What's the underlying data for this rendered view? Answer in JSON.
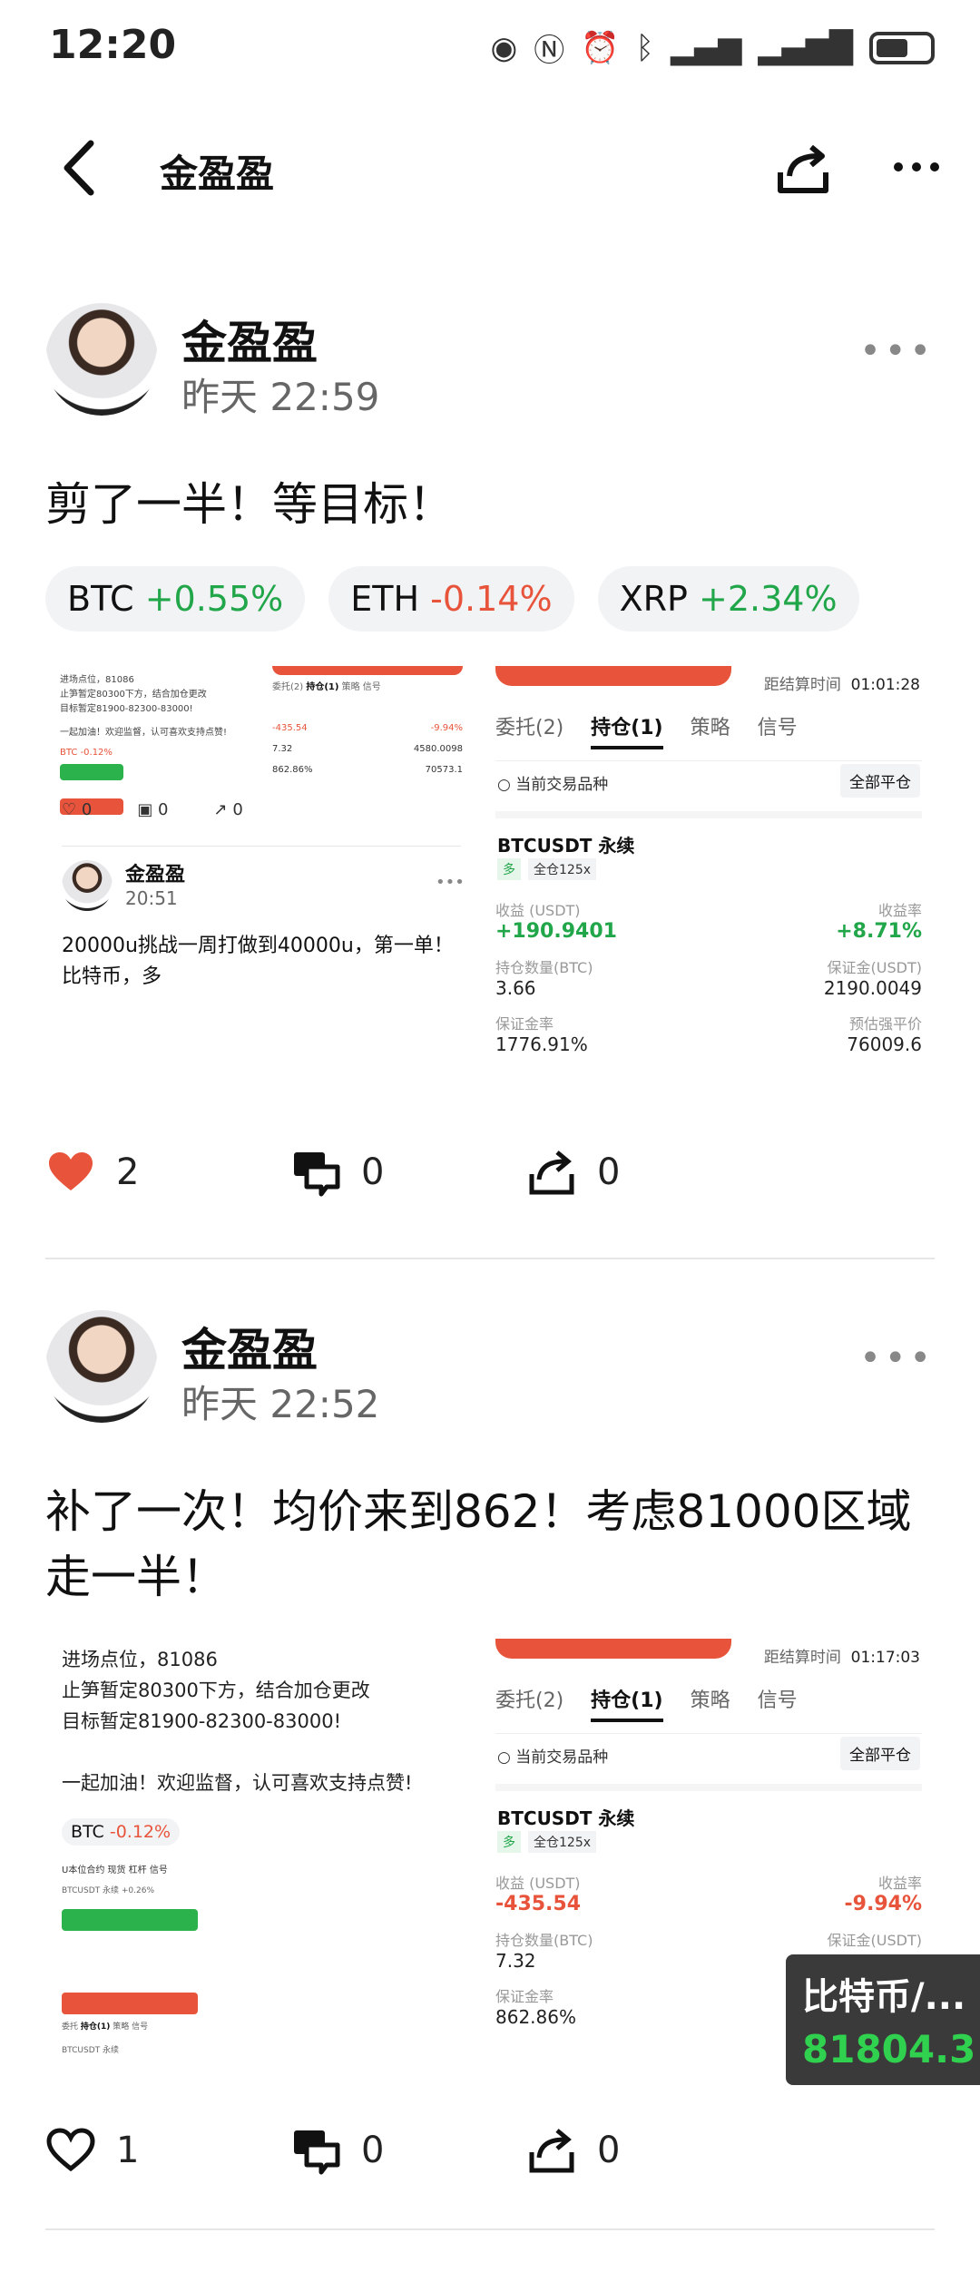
{
  "status": {
    "time": "12:20"
  },
  "nav": {
    "title": "金盈盈"
  },
  "posts": [
    {
      "author": "金盈盈",
      "time": "昨天 22:59",
      "text": "剪了一半！等目标！",
      "tickers": [
        {
          "symbol": "BTC",
          "change": "+0.55%"
        },
        {
          "symbol": "ETH",
          "change": "-0.14%"
        },
        {
          "symbol": "XRP",
          "change": "+2.34%"
        }
      ],
      "quoted": {
        "author": "金盈盈",
        "time": "20:51",
        "text": "20000u挑战一周打做到40000u，第一单！\n比特币，多\n进场点位，81086",
        "likes": "0",
        "comments": "0",
        "shares": "0"
      },
      "shot": {
        "countdown_label": "距结算时间",
        "countdown": "01:01:28",
        "tabs": [
          "委托(2)",
          "持仓(1)",
          "策略",
          "信号"
        ],
        "current_only": "当前交易品种",
        "close_all": "全部平仓",
        "symbol": "BTCUSDT 永续",
        "side": "多",
        "leverage": "全仓125x",
        "pnl_label": "收益 (USDT)",
        "pnl": "+190.9401",
        "roe_label": "收益率",
        "roe": "+8.71%",
        "qty_label": "持仓数量(BTC)",
        "qty": "3.66",
        "margin_label": "保证金(USDT)",
        "margin": "2190.0049",
        "mrate_label": "保证金率",
        "mrate": "1776.91%",
        "liq_label": "预估强平价",
        "liq": "76009.6"
      },
      "likes": "2",
      "comments": "0",
      "shares": "0"
    },
    {
      "author": "金盈盈",
      "time": "昨天 22:52",
      "text": "补了一次！均价来到862！考虑81000区域走一半！",
      "quoted_lines": [
        "进场点位，81086",
        "止笋暂定80300下方，结合加仓更改",
        "目标暂定81900-82300-83000!",
        "",
        "一起加油！欢迎监督，认可喜欢支持点赞!"
      ],
      "quoted_tag": {
        "symbol": "BTC",
        "change": "-0.12%"
      },
      "shot": {
        "countdown_label": "距结算时间",
        "countdown": "01:17:03",
        "tabs": [
          "委托(2)",
          "持仓(1)",
          "策略",
          "信号"
        ],
        "current_only": "当前交易品种",
        "close_all": "全部平仓",
        "symbol": "BTCUSDT 永续",
        "side": "多",
        "leverage": "全仓125x",
        "pnl_label": "收益 (USDT)",
        "pnl": "-435.54",
        "roe_label": "收益率",
        "roe": "-9.94%",
        "qty_label": "持仓数量(BTC)",
        "qty": "7.32",
        "margin_label": "保证金(USDT)",
        "mrate_label": "保证金率",
        "mrate": "862.86%"
      },
      "likes": "1",
      "comments": "0",
      "shares": "0"
    }
  ],
  "floating_ticker": {
    "name": "比特币/...",
    "price": "81804.3"
  },
  "colors": {
    "up": "#21a64a",
    "down": "#e8543b",
    "like": "#e8543b"
  }
}
